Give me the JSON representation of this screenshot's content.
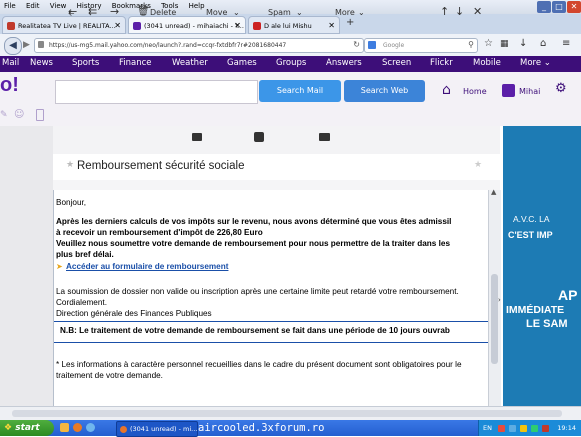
{
  "menubar": {
    "items": [
      "File",
      "Edit",
      "View",
      "History",
      "Bookmarks",
      "Tools",
      "Help"
    ]
  },
  "tabs": [
    {
      "label": "Realitatea TV Live | REALITA...",
      "color": "#c0392b"
    },
    {
      "label": "(3041 unread) - mihaiachi - Y...",
      "color": "#5b1fa8"
    },
    {
      "label": "D ale lui Mishu",
      "color": "#cc2222"
    }
  ],
  "new_tab_label": "+",
  "address": {
    "url": "https://us-mg5.mail.yahoo.com/neo/launch?.rand=ccqr-fxtdbfr7r#2081680447"
  },
  "search": {
    "engine": "Google",
    "placeholder": "Google"
  },
  "yahoo_nav": {
    "items": [
      "Mail",
      "News",
      "Sports",
      "Finance",
      "Weather",
      "Games",
      "Groups",
      "Answers",
      "Screen",
      "Flickr",
      "Mobile",
      "More ⌄"
    ]
  },
  "logo_fragment": "o!",
  "yahoo_header": {
    "search_mail": "Search Mail",
    "search_web": "Search Web",
    "home": "Home",
    "user": "Mihai"
  },
  "toolbar": {
    "delete": "Delete",
    "move": "Move",
    "spam": "Spam",
    "more": "More"
  },
  "message": {
    "subject": "Remboursement sécurité sociale",
    "greeting": "Bonjour,",
    "para1_line1": "Après les derniers calculs de vos impôts sur le revenu, nous avons déterminé que vous êtes admissil",
    "para1_line2": "à recevoir un remboursement d'impôt de 226,80 Euro",
    "para1_line3": "Veuillez nous soumettre votre demande de remboursement pour nous permettre de la traiter dans les",
    "para1_line4": "plus bref délai.",
    "link": "Accéder au formulaire de remboursement",
    "para2_line1": "La soumission de dossier non valide ou inscription après une certaine limite peut retardé votre remboursement.",
    "para2_line2": "Cordialement.",
    "para2_line3": "Direction générale des Finances Publiques",
    "notice": "N.B: Le traitement de votre demande de remboursement se fait dans une période de 10 jours ouvrab",
    "footer_line1": "* Les informations à caractère personnel recueillies dans le cadre du présent document sont obligatoires pour le",
    "footer_line2": "traitement de votre demande."
  },
  "ad": {
    "line1": "A.V.C. LA",
    "line2": "C'EST IMP",
    "line3": "AP",
    "line4": "IMMÉDIATE",
    "line5": "LE SAM"
  },
  "taskbar": {
    "start": "start",
    "window": "(3041 unread) - mi...",
    "watermark": "aircooled.3xforum.ro",
    "lang": "EN",
    "clock": "19:14"
  },
  "colors": {
    "yahoo_purple": "#3d0e79",
    "search_blue": "#3c96e8",
    "link_blue": "#1a4fa8",
    "ad_blue": "#1d7bb4"
  }
}
